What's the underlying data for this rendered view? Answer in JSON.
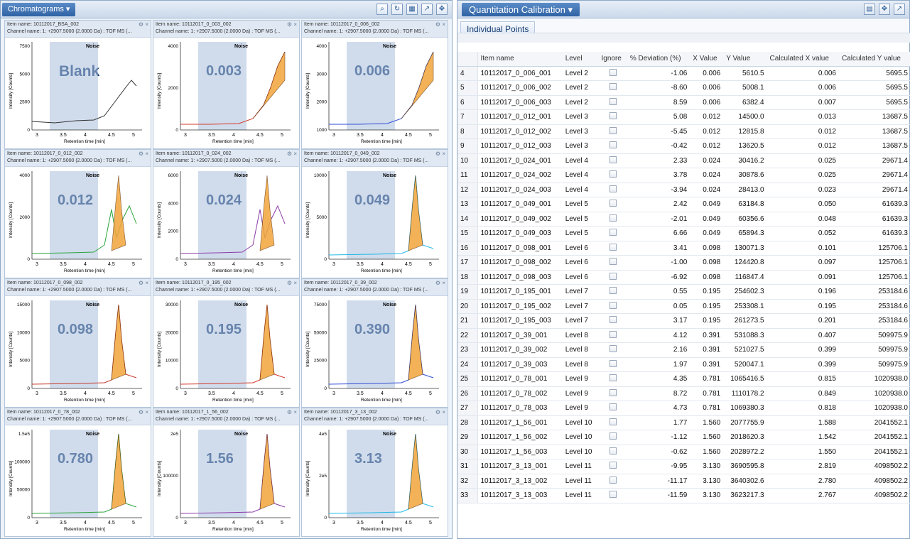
{
  "left_pane": {
    "title": "Chromatograms ▾",
    "tools": [
      "zoom-icon",
      "refresh-icon",
      "chart-icon",
      "export-icon",
      "move-icon"
    ],
    "panels": [
      {
        "item": "Item name: 10112017_BSA_002",
        "channel": "Channel name: 1: +2907.5000 (2.0000 Da) : TOF MS (...",
        "label": "Blank",
        "color": "#333333",
        "yticks": [
          "7500",
          "5000",
          "2500",
          "0"
        ],
        "shape": "blank"
      },
      {
        "item": "Item name: 10112017_0_003_002",
        "channel": "Channel name: 1: +2907.5000 (2.0000 Da) : TOF MS (...",
        "label": "0.003",
        "color": "#d23a2a",
        "yticks": [
          "4000",
          "2000",
          "0"
        ],
        "shape": "rise"
      },
      {
        "item": "Item name: 10112017_0_006_002",
        "channel": "Channel name: 1: +2907.5000 (2.0000 Da) : TOF MS (...",
        "label": "0.006",
        "color": "#2f4bd1",
        "yticks": [
          "4000",
          "3000",
          "2000",
          "1000"
        ],
        "shape": "rise"
      },
      {
        "item": "Item name: 10112017_0_012_002",
        "channel": "Channel name: 1: +2907.5000 (2.0000 Da) : TOF MS (...",
        "label": "0.012",
        "color": "#2aa33a",
        "yticks": [
          "4000",
          "2000",
          "0"
        ],
        "shape": "peak2"
      },
      {
        "item": "Item name: 10112017_0_024_002",
        "channel": "Channel name: 1: +2907.5000 (2.0000 Da) : TOF MS (...",
        "label": "0.024",
        "color": "#8b3aa8",
        "yticks": [
          "6000",
          "4000",
          "2000",
          "0"
        ],
        "shape": "peak2"
      },
      {
        "item": "Item name: 10112017_0_049_002",
        "channel": "Channel name: 1: +2907.5000 (2.0000 Da) : TOF MS (...",
        "label": "0.049",
        "color": "#20b9e6",
        "yticks": [
          "10000",
          "5000",
          "0"
        ],
        "shape": "peak"
      },
      {
        "item": "Item name: 10112017_0_098_002",
        "channel": "Channel name: 1: +2907.5000 (2.0000 Da) : TOF MS (...",
        "label": "0.098",
        "color": "#c23a2a",
        "yticks": [
          "15000",
          "10000",
          "5000",
          "0"
        ],
        "shape": "peak"
      },
      {
        "item": "Item name: 10112017_0_195_002",
        "channel": "Channel name: 1: +2907.5000 (2.0000 Da) : TOF MS (...",
        "label": "0.195",
        "color": "#d23a2a",
        "yticks": [
          "30000",
          "20000",
          "10000",
          "0"
        ],
        "shape": "peak"
      },
      {
        "item": "Item name: 10112017_0_39_002",
        "channel": "Channel name: 1: +2907.5000 (2.0000 Da) : TOF MS (...",
        "label": "0.390",
        "color": "#2f4bd1",
        "yticks": [
          "75000",
          "50000",
          "25000",
          "0"
        ],
        "shape": "peak"
      },
      {
        "item": "Item name: 10112017_0_78_002",
        "channel": "Channel name: 1: +2907.5000 (2.0000 Da) : TOF MS (...",
        "label": "0.780",
        "color": "#2aa33a",
        "yticks": [
          "1.5e5",
          "100000",
          "50000",
          "0"
        ],
        "shape": "peak"
      },
      {
        "item": "Item name: 10112017_1_56_002",
        "channel": "Channel name: 1: +2907.5000 (2.0000 Da) : TOF MS (...",
        "label": "1.56",
        "color": "#8b3aa8",
        "yticks": [
          "2e5",
          "100000",
          "0"
        ],
        "shape": "peak"
      },
      {
        "item": "Item name: 10112017_3_13_002",
        "channel": "Channel name: 1: +2907.5000 (2.0000 Da) : TOF MS (...",
        "label": "3.13",
        "color": "#20b9e6",
        "yticks": [
          "4e5",
          "2e5",
          "0"
        ],
        "shape": "peak"
      }
    ],
    "xticks": [
      "3",
      "3.5",
      "4",
      "4.5",
      "5"
    ],
    "xlabel": "Retention time [min]",
    "ylabel": "Intensity [Counts]",
    "noise_label": "Noise"
  },
  "right_pane": {
    "title": "Quantitation Calibration ▾",
    "tab": "Individual Points",
    "columns": [
      "Item name",
      "Level",
      "Ignore",
      "% Deviation (%)",
      "X Value",
      "Y Value",
      "Calculated X value",
      "Calculated Y value"
    ],
    "rows": [
      {
        "n": "4",
        "name": "10112017_0_006_001",
        "level": "Level 2",
        "dev": "-1.06",
        "x": "0.006",
        "y": "5610.5",
        "cx": "0.006",
        "cy": "5695.5"
      },
      {
        "n": "5",
        "name": "10112017_0_006_002",
        "level": "Level 2",
        "dev": "-8.60",
        "x": "0.006",
        "y": "5008.1",
        "cx": "0.006",
        "cy": "5695.5"
      },
      {
        "n": "6",
        "name": "10112017_0_006_003",
        "level": "Level 2",
        "dev": "8.59",
        "x": "0.006",
        "y": "6382.4",
        "cx": "0.007",
        "cy": "5695.5"
      },
      {
        "n": "7",
        "name": "10112017_0_012_001",
        "level": "Level 3",
        "dev": "5.08",
        "x": "0.012",
        "y": "14500.0",
        "cx": "0.013",
        "cy": "13687.5"
      },
      {
        "n": "8",
        "name": "10112017_0_012_002",
        "level": "Level 3",
        "dev": "-5.45",
        "x": "0.012",
        "y": "12815.8",
        "cx": "0.012",
        "cy": "13687.5"
      },
      {
        "n": "9",
        "name": "10112017_0_012_003",
        "level": "Level 3",
        "dev": "-0.42",
        "x": "0.012",
        "y": "13620.5",
        "cx": "0.012",
        "cy": "13687.5"
      },
      {
        "n": "10",
        "name": "10112017_0_024_001",
        "level": "Level 4",
        "dev": "2.33",
        "x": "0.024",
        "y": "30416.2",
        "cx": "0.025",
        "cy": "29671.4"
      },
      {
        "n": "11",
        "name": "10112017_0_024_002",
        "level": "Level 4",
        "dev": "3.78",
        "x": "0.024",
        "y": "30878.6",
        "cx": "0.025",
        "cy": "29671.4"
      },
      {
        "n": "12",
        "name": "10112017_0_024_003",
        "level": "Level 4",
        "dev": "-3.94",
        "x": "0.024",
        "y": "28413.0",
        "cx": "0.023",
        "cy": "29671.4"
      },
      {
        "n": "13",
        "name": "10112017_0_049_001",
        "level": "Level 5",
        "dev": "2.42",
        "x": "0.049",
        "y": "63184.8",
        "cx": "0.050",
        "cy": "61639.3"
      },
      {
        "n": "14",
        "name": "10112017_0_049_002",
        "level": "Level 5",
        "dev": "-2.01",
        "x": "0.049",
        "y": "60356.6",
        "cx": "0.048",
        "cy": "61639.3"
      },
      {
        "n": "15",
        "name": "10112017_0_049_003",
        "level": "Level 5",
        "dev": "6.66",
        "x": "0.049",
        "y": "65894.3",
        "cx": "0.052",
        "cy": "61639.3"
      },
      {
        "n": "16",
        "name": "10112017_0_098_001",
        "level": "Level 6",
        "dev": "3.41",
        "x": "0.098",
        "y": "130071.3",
        "cx": "0.101",
        "cy": "125706.1"
      },
      {
        "n": "17",
        "name": "10112017_0_098_002",
        "level": "Level 6",
        "dev": "-1.00",
        "x": "0.098",
        "y": "124420.8",
        "cx": "0.097",
        "cy": "125706.1"
      },
      {
        "n": "18",
        "name": "10112017_0_098_003",
        "level": "Level 6",
        "dev": "-6.92",
        "x": "0.098",
        "y": "116847.4",
        "cx": "0.091",
        "cy": "125706.1"
      },
      {
        "n": "19",
        "name": "10112017_0_195_001",
        "level": "Level 7",
        "dev": "0.55",
        "x": "0.195",
        "y": "254602.3",
        "cx": "0.196",
        "cy": "253184.6"
      },
      {
        "n": "20",
        "name": "10112017_0_195_002",
        "level": "Level 7",
        "dev": "0.05",
        "x": "0.195",
        "y": "253308.1",
        "cx": "0.195",
        "cy": "253184.6"
      },
      {
        "n": "21",
        "name": "10112017_0_195_003",
        "level": "Level 7",
        "dev": "3.17",
        "x": "0.195",
        "y": "261273.5",
        "cx": "0.201",
        "cy": "253184.6"
      },
      {
        "n": "22",
        "name": "10112017_0_39_001",
        "level": "Level 8",
        "dev": "4.12",
        "x": "0.391",
        "y": "531088.3",
        "cx": "0.407",
        "cy": "509975.9"
      },
      {
        "n": "23",
        "name": "10112017_0_39_002",
        "level": "Level 8",
        "dev": "2.16",
        "x": "0.391",
        "y": "521027.5",
        "cx": "0.399",
        "cy": "509975.9"
      },
      {
        "n": "24",
        "name": "10112017_0_39_003",
        "level": "Level 8",
        "dev": "1.97",
        "x": "0.391",
        "y": "520047.1",
        "cx": "0.399",
        "cy": "509975.9"
      },
      {
        "n": "25",
        "name": "10112017_0_78_001",
        "level": "Level 9",
        "dev": "4.35",
        "x": "0.781",
        "y": "1065416.5",
        "cx": "0.815",
        "cy": "1020938.0"
      },
      {
        "n": "26",
        "name": "10112017_0_78_002",
        "level": "Level 9",
        "dev": "8.72",
        "x": "0.781",
        "y": "1110178.2",
        "cx": "0.849",
        "cy": "1020938.0"
      },
      {
        "n": "27",
        "name": "10112017_0_78_003",
        "level": "Level 9",
        "dev": "4.73",
        "x": "0.781",
        "y": "1069380.3",
        "cx": "0.818",
        "cy": "1020938.0"
      },
      {
        "n": "28",
        "name": "10112017_1_56_001",
        "level": "Level 10",
        "dev": "1.77",
        "x": "1.560",
        "y": "2077755.9",
        "cx": "1.588",
        "cy": "2041552.1"
      },
      {
        "n": "29",
        "name": "10112017_1_56_002",
        "level": "Level 10",
        "dev": "-1.12",
        "x": "1.560",
        "y": "2018620.3",
        "cx": "1.542",
        "cy": "2041552.1"
      },
      {
        "n": "30",
        "name": "10112017_1_56_003",
        "level": "Level 10",
        "dev": "-0.62",
        "x": "1.560",
        "y": "2028972.2",
        "cx": "1.550",
        "cy": "2041552.1"
      },
      {
        "n": "31",
        "name": "10112017_3_13_001",
        "level": "Level 11",
        "dev": "-9.95",
        "x": "3.130",
        "y": "3690595.8",
        "cx": "2.819",
        "cy": "4098502.2"
      },
      {
        "n": "32",
        "name": "10112017_3_13_002",
        "level": "Level 11",
        "dev": "-11.17",
        "x": "3.130",
        "y": "3640302.6",
        "cx": "2.780",
        "cy": "4098502.2"
      },
      {
        "n": "33",
        "name": "10112017_3_13_003",
        "level": "Level 11",
        "dev": "-11.59",
        "x": "3.130",
        "y": "3623217.3",
        "cx": "2.767",
        "cy": "4098502.2"
      }
    ]
  }
}
